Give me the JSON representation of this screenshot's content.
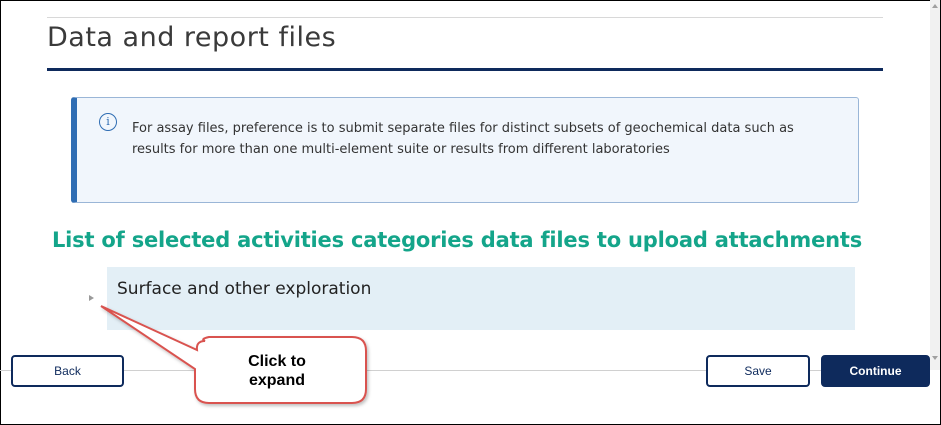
{
  "page": {
    "title": "Data and report files"
  },
  "info": {
    "icon": "info-circle-icon",
    "text": "For assay files, preference is to submit separate files for distinct subsets of geochemical data such as results for more than one multi-element suite or results from different laboratories"
  },
  "activities": {
    "heading": "List of selected activities categories data files to upload attachments",
    "categories": [
      {
        "label": "Surface and other exploration",
        "expanded": false
      }
    ]
  },
  "callout": {
    "text": "Click to expand"
  },
  "footer": {
    "back_label": "Back",
    "save_label": "Save",
    "continue_label": "Continue"
  },
  "colors": {
    "brand_navy": "#0e2a5c",
    "heading_green": "#14a58a",
    "info_accent": "#2f6db3",
    "category_bg": "#e3eff6",
    "callout_red": "#d9534f"
  }
}
